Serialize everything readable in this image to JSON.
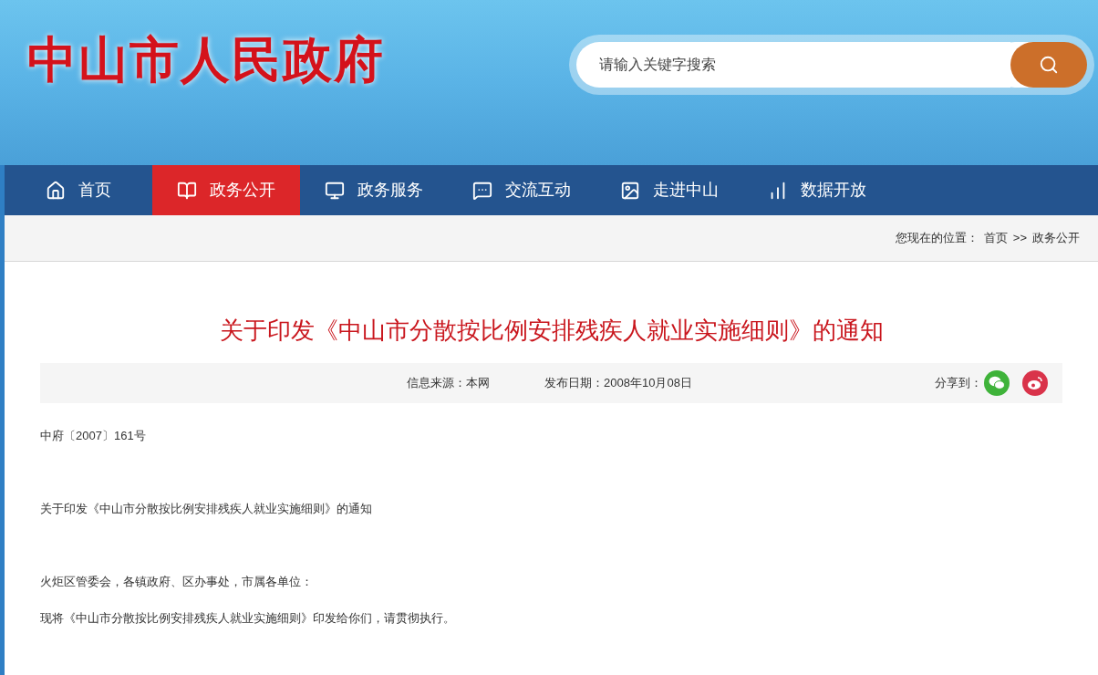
{
  "header": {
    "logo": "中山市人民政府",
    "search": {
      "placeholder": "请输入关键字搜索"
    }
  },
  "nav": [
    {
      "kind": "home",
      "label": "首页",
      "selected": false
    },
    {
      "kind": "book",
      "label": "政务公开",
      "selected": true
    },
    {
      "kind": "monitor",
      "label": "政务服务",
      "selected": false
    },
    {
      "kind": "chat",
      "label": "交流互动",
      "selected": false
    },
    {
      "kind": "image",
      "label": "走进中山",
      "selected": false
    },
    {
      "kind": "chart",
      "label": "数据开放",
      "selected": false
    }
  ],
  "breadcrumb": {
    "label": "您现在的位置：",
    "items": [
      "首页",
      "政务公开"
    ],
    "separator": ">>"
  },
  "article": {
    "title": "关于印发《中山市分散按比例安排残疾人就业实施细则》的通知",
    "source": "信息来源：本网",
    "date": "发布日期：2008年10月08日",
    "share_label": "分享到：",
    "share": [
      {
        "kind": "wechat"
      },
      {
        "kind": "weibo"
      }
    ],
    "paragraphs": [
      "中府〔2007〕161号",
      "关于印发《中山市分散按比例安排残疾人就业实施细则》的通知",
      "火炬区管委会，各镇政府、区办事处，市属各单位：",
      "现将《中山市分散按比例安排残疾人就业实施细则》印发给你们，请贯彻执行。"
    ]
  }
}
